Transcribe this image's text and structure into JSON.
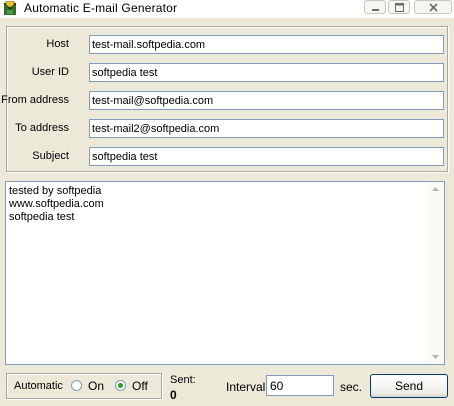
{
  "window": {
    "title": "Automatic E-mail Generator"
  },
  "titlebar_icons": {
    "app": "envelope-icon",
    "minimize": "minimize-icon",
    "maximize": "maximize-icon",
    "close": "close-icon"
  },
  "fields": {
    "host": {
      "label": "Host",
      "value": "test-mail.softpedia.com"
    },
    "user_id": {
      "label": "User ID",
      "value": "softpedia test"
    },
    "from_address": {
      "label": "From address",
      "value": "test-mail@softpedia.com"
    },
    "to_address": {
      "label": "To address",
      "value": "test-mail2@softpedia.com"
    },
    "subject": {
      "label": "Subject",
      "value": "softpedia test"
    }
  },
  "message_body": {
    "text": "tested by softpedia\nwww.softpedia.com\nsoftpedia test"
  },
  "controls": {
    "automatic_label": "Automatic",
    "on_label": "On",
    "off_label": "Off",
    "selected": "Off",
    "sent_label": "Sent:",
    "sent_count": "0",
    "interval_label": "Interval",
    "interval_value": "60",
    "interval_unit": "sec.",
    "send_label": "Send"
  },
  "colors": {
    "window_bg": "#ECE9D8",
    "input_border": "#7F9DB9",
    "radio_checked": "#21a121"
  }
}
